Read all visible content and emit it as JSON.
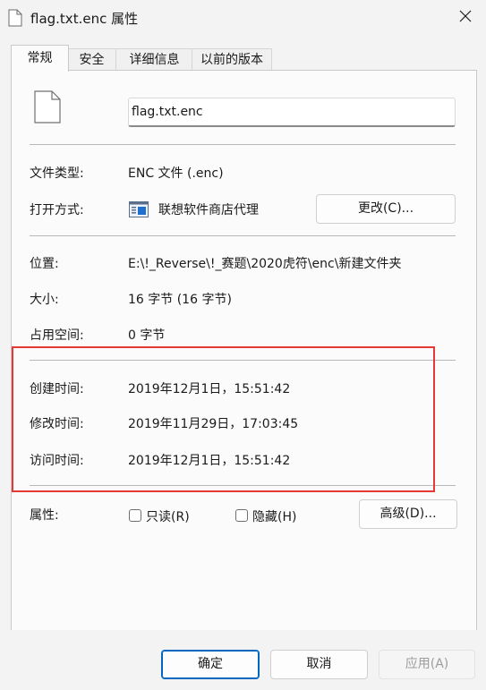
{
  "window": {
    "title": "flag.txt.enc 属性",
    "icons": {
      "title": "document-icon",
      "close": "close-icon"
    }
  },
  "tabs": [
    {
      "label": "常规",
      "active": true
    },
    {
      "label": "安全"
    },
    {
      "label": "详细信息"
    },
    {
      "label": "以前的版本"
    }
  ],
  "general": {
    "file_name": "flag.txt.enc",
    "file_type_label": "文件类型:",
    "file_type_value": "ENC 文件 (.enc)",
    "opens_with_label": "打开方式:",
    "opens_with_value": "联想软件商店代理",
    "change_button": "更改(C)...",
    "location_label": "位置:",
    "location_value": "E:\\!_Reverse\\!_赛题\\2020虎符\\enc\\新建文件夹",
    "size_label": "大小:",
    "size_value": "16 字节 (16 字节)",
    "disk_size_label": "占用空间:",
    "disk_size_value": "0 字节",
    "created_label": "创建时间:",
    "created_value": "2019年12月1日，15:51:42",
    "modified_label": "修改时间:",
    "modified_value": "2019年11月29日，17:03:45",
    "accessed_label": "访问时间:",
    "accessed_value": "2019年12月1日，15:51:42",
    "attributes_label": "属性:",
    "readonly_label": "只读(R)",
    "readonly_checked": false,
    "hidden_label": "隐藏(H)",
    "hidden_checked": false,
    "advanced_button": "高级(D)..."
  },
  "footer": {
    "ok": "确定",
    "cancel": "取消",
    "apply": "应用(A)"
  },
  "colors": {
    "highlight_border": "#e53935",
    "primary_border": "#0067c0",
    "app_icon_blue": "#1e6fd0"
  }
}
